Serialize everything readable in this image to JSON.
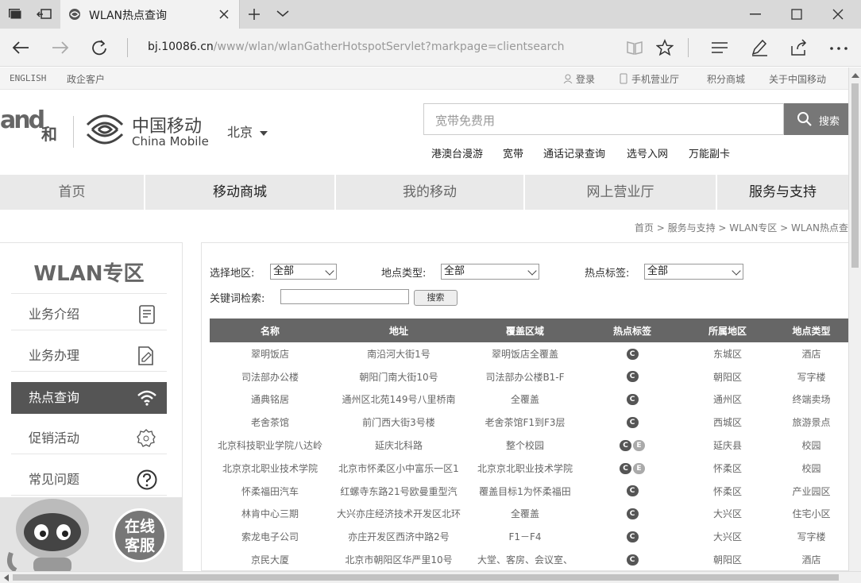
{
  "browser": {
    "tab_title": "WLAN热点查询",
    "url_domain": "bj.10086.cn",
    "url_path": "/www/wlan/wlanGatherHotspotServlet?markpage=clientsearch"
  },
  "topnav": {
    "left": [
      "ENGLISH",
      "政企客户"
    ],
    "right": [
      "登录",
      "手机营业厅",
      "积分商城",
      "关于中国移动"
    ]
  },
  "header": {
    "logo_and": "and",
    "logo_he": "和",
    "brand_cn": "中国移动",
    "brand_en": "China Mobile",
    "city": "北京",
    "search_placeholder": "宽带免费用",
    "search_button": "搜索",
    "hot_links": [
      "港澳台漫游",
      "宽带",
      "通话记录查询",
      "选号入网",
      "万能副卡"
    ]
  },
  "mainnav": [
    "首页",
    "移动商城",
    "我的移动",
    "网上营业厅",
    "服务与支持"
  ],
  "breadcrumb": "首页 > 服务与支持 > WLAN专区 > WLAN热点查",
  "sidebar": {
    "title": "WLAN专区",
    "items": [
      "业务介绍",
      "业务办理",
      "热点查询",
      "促销活动",
      "常见问题"
    ],
    "service_text": "在线客服"
  },
  "filters": {
    "region_label": "选择地区:",
    "region_value": "全部",
    "type_label": "地点类型:",
    "type_value": "全部",
    "tag_label": "热点标签:",
    "tag_value": "全部",
    "keyword_label": "关键词检索:",
    "keyword_value": "",
    "search_button": "搜索"
  },
  "table": {
    "headers": [
      "名称",
      "地址",
      "覆盖区域",
      "热点标签",
      "所属地区",
      "地点类型"
    ],
    "rows": [
      {
        "name": "翠明饭店",
        "addr": "南沿河大街1号",
        "area": "翠明饭店全覆盖",
        "tags": [
          "C"
        ],
        "district": "东城区",
        "type": "酒店"
      },
      {
        "name": "司法部办公楼",
        "addr": "朝阳门南大街10号",
        "area": "司法部办公楼B1-F",
        "tags": [
          "C"
        ],
        "district": "朝阳区",
        "type": "写字楼"
      },
      {
        "name": "通典铭居",
        "addr": "通州区北苑149号八里桥南",
        "area": "全覆盖",
        "tags": [
          "C"
        ],
        "district": "通州区",
        "type": "终端卖场"
      },
      {
        "name": "老舍茶馆",
        "addr": "前门西大街3号楼",
        "area": "老舍茶馆F1到F3层",
        "tags": [
          "C"
        ],
        "district": "西城区",
        "type": "旅游景点"
      },
      {
        "name": "北京科技职业学院八达岭",
        "addr": "延庆北科路",
        "area": "整个校园",
        "tags": [
          "C",
          "E"
        ],
        "district": "延庆县",
        "type": "校园"
      },
      {
        "name": "北京京北职业技术学院",
        "addr": "北京市怀柔区小中富乐一区1",
        "area": "北京京北职业技术学院",
        "tags": [
          "C",
          "E"
        ],
        "district": "怀柔区",
        "type": "校园"
      },
      {
        "name": "怀柔福田汽车",
        "addr": "红螺寺东路21号欧曼重型汽",
        "area": "覆盖目标1为怀柔福田",
        "tags": [
          "C"
        ],
        "district": "怀柔区",
        "type": "产业园区"
      },
      {
        "name": "林肯中心三期",
        "addr": "大兴亦庄经济技术开发区北环",
        "area": "全覆盖",
        "tags": [
          "C"
        ],
        "district": "大兴区",
        "type": "住宅小区"
      },
      {
        "name": "索龙电子公司",
        "addr": "亦庄开发区西济中路2号",
        "area": "F1－F4",
        "tags": [
          "C"
        ],
        "district": "大兴区",
        "type": "写字楼"
      },
      {
        "name": "京民大厦",
        "addr": "北京市朝阳区华严里10号",
        "area": "大堂、客房、会议室、",
        "tags": [
          "C"
        ],
        "district": "朝阳区",
        "type": "酒店"
      }
    ]
  }
}
